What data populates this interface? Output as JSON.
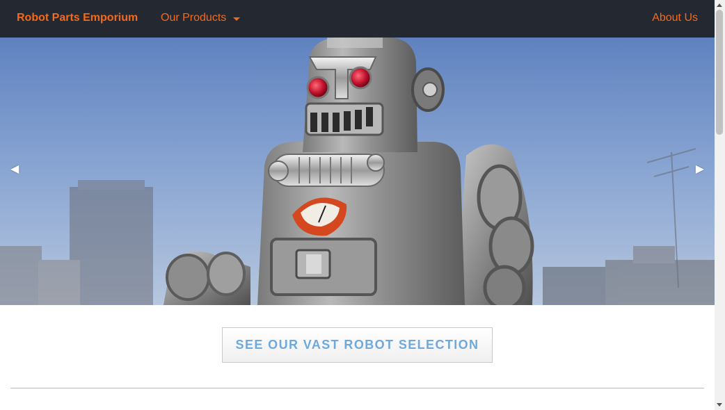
{
  "navbar": {
    "brand": "Robot Parts Emporium",
    "products_label": "Our Products",
    "about_label": "About Us",
    "accent_color": "#f26b1d",
    "background_color": "#232831"
  },
  "carousel": {
    "prev_arrow": "◀",
    "next_arrow": "▶",
    "slide_image": "tin-toy-robot-photo"
  },
  "cta": {
    "label": "SEE OUR VAST ROBOT SELECTION",
    "text_color": "#6da9dc"
  },
  "icons": {
    "dropdown": "caret-down-icon",
    "prev": "arrow-left-icon",
    "next": "arrow-right-icon"
  }
}
